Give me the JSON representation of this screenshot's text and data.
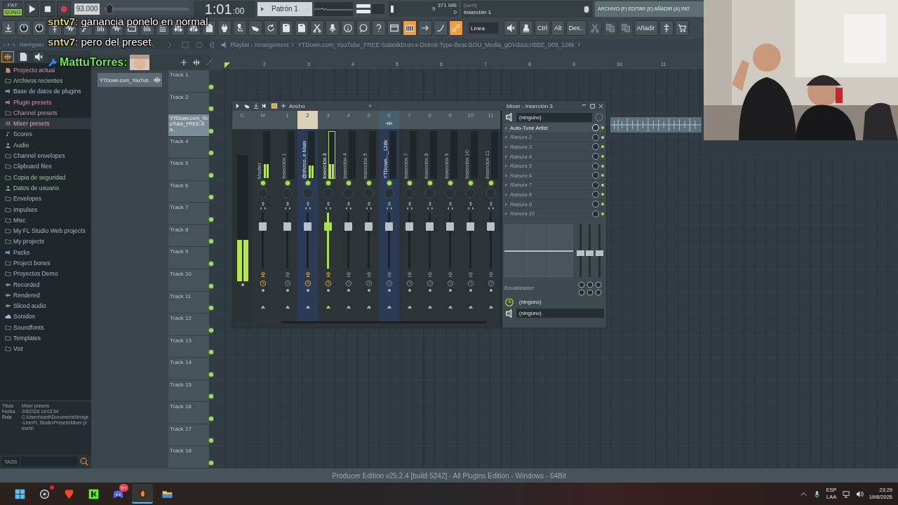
{
  "chat": [
    {
      "user": "sntv7",
      "text": ": ganancia ponelo en normal",
      "avatar": false
    },
    {
      "user": "sntv7",
      "text": ": pero del preset",
      "avatar": false
    },
    {
      "user": "MattuTorres:",
      "avatar": true
    }
  ],
  "transport": {
    "mode_labels": [
      "PAT",
      "SONG"
    ],
    "song_mode": true,
    "tempo": "93.000",
    "position_slider": {
      "level": 0.02
    },
    "time": "1:01",
    "time_small": ":00",
    "pattern": "Patrón 1",
    "cpu": "9",
    "memory": "371 MB",
    "polyphony": "0",
    "hint_title": "[santi]",
    "hint_text": "Inserción 1",
    "menu_hint": "ARCHIVO (F) EDITAR (E) AÑADIR (A) PAT"
  },
  "toolbar": [
    {
      "kind": "icon",
      "on": false,
      "disabled": false
    },
    {
      "kind": "icon",
      "on": false,
      "disabled": false
    },
    {
      "kind": "icon",
      "on": false,
      "disabled": false
    },
    {
      "kind": "icon",
      "on": false,
      "disabled": false
    },
    {
      "kind": "icon",
      "on": false,
      "disabled": false
    },
    {
      "kind": "icon",
      "on": false,
      "disabled": false
    },
    {
      "kind": "icon",
      "on": false,
      "disabled": false
    },
    {
      "kind": "icon",
      "on": false,
      "disabled": false
    },
    {
      "kind": "icon",
      "on": false,
      "disabled": false
    },
    {
      "kind": "icon",
      "on": false,
      "disabled": false
    },
    {
      "kind": "icon",
      "on": false,
      "disabled": false
    },
    {
      "kind": "icon",
      "on": false,
      "disabled": false
    },
    {
      "kind": "icon",
      "on": false,
      "disabled": false
    },
    {
      "kind": "icon",
      "on": false,
      "disabled": false
    },
    {
      "kind": "icon",
      "on": false,
      "disabled": false
    },
    {
      "kind": "icon",
      "on": false,
      "disabled": false
    },
    {
      "kind": "icon",
      "on": false,
      "disabled": false
    },
    {
      "kind": "icon",
      "on": false,
      "disabled": false
    },
    {
      "kind": "icon",
      "on": false,
      "disabled": false
    },
    {
      "kind": "icon",
      "on": false,
      "disabled": false
    },
    {
      "kind": "icon",
      "on": false,
      "disabled": false
    },
    {
      "kind": "icon",
      "on": false,
      "disabled": false
    },
    {
      "kind": "icon",
      "on": false,
      "disabled": false
    },
    {
      "kind": "icon",
      "on": false,
      "disabled": false
    },
    {
      "kind": "icon",
      "on": false,
      "disabled": false
    },
    {
      "kind": "icon",
      "on": false,
      "disabled": false
    },
    {
      "kind": "icon",
      "on": true,
      "disabled": false
    },
    {
      "kind": "icon",
      "on": false,
      "disabled": false
    },
    {
      "kind": "icon",
      "on": false,
      "disabled": false
    },
    {
      "kind": "icon",
      "on": true,
      "disabled": false
    },
    {
      "kind": "dropdown",
      "label": "Línea",
      "on": false,
      "disabled": false
    },
    {
      "kind": "icon",
      "on": false,
      "disabled": false
    },
    {
      "kind": "icon",
      "on": false,
      "disabled": false
    },
    {
      "kind": "text",
      "label": "Ctrl",
      "on": false,
      "disabled": false
    },
    {
      "kind": "text",
      "label": "Alt",
      "on": false,
      "disabled": false
    },
    {
      "kind": "text",
      "label": "Des..",
      "on": false,
      "disabled": false
    },
    {
      "kind": "icon",
      "on": false,
      "disabled": true
    },
    {
      "kind": "icon",
      "on": false,
      "disabled": true
    },
    {
      "kind": "icon",
      "on": false,
      "disabled": true
    },
    {
      "kind": "text",
      "label": "Añadir",
      "on": false,
      "disabled": false
    },
    {
      "kind": "icon",
      "on": false,
      "disabled": false
    },
    {
      "kind": "icon",
      "on": false,
      "disabled": false
    }
  ],
  "navigation": {
    "browser_label": "Navegado",
    "playlist_title": "Playlist - Arrangement",
    "playlist_file": "YTDown.com_YouTube_FREE-Salastkbron-x-Detroit-Type-Beat-BOU_Media_gDVdouLH5BE_009_128k"
  },
  "browser": {
    "items": [
      {
        "label": "Proyecto actual",
        "kind": "project",
        "selected": false
      },
      {
        "label": "Archivos recientes",
        "kind": "recent",
        "selected": false
      },
      {
        "label": "Base de datos de plugins",
        "kind": "plugins",
        "selected": false
      },
      {
        "label": "Plugin presets",
        "kind": "presets",
        "selected": false
      },
      {
        "label": "Channel presets",
        "kind": "channel",
        "selected": false
      },
      {
        "label": "Mixer presets",
        "kind": "mixer",
        "selected": true
      },
      {
        "label": "Scores",
        "kind": "scores",
        "selected": false
      },
      {
        "label": "Audio",
        "kind": "user",
        "selected": false
      },
      {
        "label": "Channel envelopes",
        "kind": "folder",
        "selected": false
      },
      {
        "label": "Clipboard files",
        "kind": "folder",
        "selected": false
      },
      {
        "label": "Copia de seguridad",
        "kind": "recent",
        "selected": false
      },
      {
        "label": "Datos de usuario",
        "kind": "user",
        "selected": false
      },
      {
        "label": "Envelopes",
        "kind": "folder",
        "selected": false
      },
      {
        "label": "Impulses",
        "kind": "folder",
        "selected": false
      },
      {
        "label": "Misc",
        "kind": "folder",
        "selected": false
      },
      {
        "label": "My FL Studio Web projects",
        "kind": "folder",
        "selected": false
      },
      {
        "label": "My projects",
        "kind": "folder",
        "selected": false
      },
      {
        "label": "Packs",
        "kind": "packs",
        "selected": false
      },
      {
        "label": "Project bones",
        "kind": "folder",
        "selected": false
      },
      {
        "label": "Proyectos Demo",
        "kind": "folder",
        "selected": false
      },
      {
        "label": "Recorded",
        "kind": "audio",
        "selected": false
      },
      {
        "label": "Rendered",
        "kind": "audio",
        "selected": false
      },
      {
        "label": "Sliced audio",
        "kind": "audio",
        "selected": false
      },
      {
        "label": "Sonidos",
        "kind": "cloud",
        "selected": false
      },
      {
        "label": "Soundfonts",
        "kind": "folder",
        "selected": false
      },
      {
        "label": "Templates",
        "kind": "folder",
        "selected": false
      },
      {
        "label": "Voz",
        "kind": "folder",
        "selected": false
      }
    ],
    "info": [
      {
        "key": "Título",
        "value": "Mixer presets"
      },
      {
        "key": "Fecha",
        "value": "2/8/2026 14:03:54"
      },
      {
        "key": "Ruta",
        "value": "C:\\Users\\santi\\Documents\\Image-Line\\FL Studio\\Presets\\Mixer presets\\"
      }
    ],
    "tags_label": "TAGS"
  },
  "picker": {
    "clips": [
      "YTDown.com_YouTub.."
    ]
  },
  "playlist": {
    "ruler": [
      "2",
      "3",
      "4",
      "5",
      "6",
      "7",
      "8",
      "9",
      "10",
      "11"
    ],
    "tracks": [
      {
        "kind": "track",
        "name": "Track 1",
        "enabled": true
      },
      {
        "kind": "track",
        "name": "Track 2",
        "enabled": true
      },
      {
        "kind": "clip",
        "name": "YTDown.com_YouTube_FREE-Sa..",
        "enabled": true
      },
      {
        "kind": "track",
        "name": "Track 4",
        "enabled": true
      },
      {
        "kind": "track",
        "name": "Track 5",
        "enabled": true
      },
      {
        "kind": "track",
        "name": "Track 6",
        "enabled": true
      },
      {
        "kind": "track",
        "name": "Track 7",
        "enabled": true
      },
      {
        "kind": "track",
        "name": "Track 8",
        "enabled": true
      },
      {
        "kind": "track",
        "name": "Track 9",
        "enabled": true
      },
      {
        "kind": "track",
        "name": "Track 10",
        "enabled": true
      },
      {
        "kind": "track",
        "name": "Track 11",
        "enabled": true
      },
      {
        "kind": "track",
        "name": "Track 12",
        "enabled": true
      },
      {
        "kind": "track",
        "name": "Track 13",
        "enabled": true
      },
      {
        "kind": "track",
        "name": "Track 14",
        "enabled": true
      },
      {
        "kind": "track",
        "name": "Track 15",
        "enabled": true
      },
      {
        "kind": "track",
        "name": "Track 16",
        "enabled": true
      },
      {
        "kind": "track",
        "name": "Track 17",
        "enabled": true
      },
      {
        "kind": "track",
        "name": "Track 18",
        "enabled": true
      }
    ]
  },
  "mixer": {
    "width_label": "Ancho",
    "current_label": "C",
    "current_meter": {
      "level": 0.33
    },
    "strips": [
      {
        "number": "M",
        "name": "Master",
        "selected": false,
        "linked": false,
        "header_lit": false,
        "audio": false,
        "send_on": true,
        "level": 0.8,
        "meter": {
          "level": 0.3
        }
      },
      {
        "number": "1",
        "name": "Inserción 1",
        "selected": false,
        "linked": false,
        "header_lit": false,
        "audio": false,
        "send_on": false,
        "level": 0.8
      },
      {
        "number": "2",
        "name": "@shzoo..e Main",
        "selected": false,
        "linked": true,
        "header_lit": true,
        "audio": false,
        "send_on": true,
        "level": 0.8,
        "meter": {
          "level": 0.28
        }
      },
      {
        "number": "3",
        "name": "Inserción 3",
        "selected": true,
        "linked": false,
        "header_lit": false,
        "audio": false,
        "send_on": true,
        "level": 0.8,
        "meter": {
          "level": 0.3
        }
      },
      {
        "number": "4",
        "name": "Inserción 4",
        "selected": false,
        "linked": false,
        "header_lit": false,
        "audio": false,
        "send_on": false,
        "level": 0.8
      },
      {
        "number": "5",
        "name": "Inserción 5",
        "selected": false,
        "linked": false,
        "header_lit": false,
        "audio": false,
        "send_on": false,
        "level": 0.8
      },
      {
        "number": "6",
        "name": "YTDown..._128k",
        "selected": false,
        "linked": true,
        "header_lit": false,
        "audio": true,
        "send_on": false,
        "level": 0.8
      },
      {
        "number": "7",
        "name": "Inserción 7",
        "selected": false,
        "linked": false,
        "header_lit": false,
        "audio": false,
        "send_on": false,
        "level": 0.8
      },
      {
        "number": "8",
        "name": "Inserción 8",
        "selected": false,
        "linked": false,
        "header_lit": false,
        "audio": false,
        "send_on": false,
        "level": 0.8
      },
      {
        "number": "9",
        "name": "Inserción 9",
        "selected": false,
        "linked": false,
        "header_lit": false,
        "audio": false,
        "send_on": false,
        "level": 0.8
      },
      {
        "number": "10",
        "name": "Inserción 10",
        "selected": false,
        "linked": false,
        "header_lit": false,
        "audio": false,
        "send_on": false,
        "level": 0.8
      },
      {
        "number": "11",
        "name": "Inserción 11",
        "selected": false,
        "linked": false,
        "header_lit": false,
        "audio": false,
        "send_on": false,
        "level": 0.8
      }
    ],
    "inspector": {
      "title": "Mixer - Inserción 3",
      "input": "(ninguno)",
      "slots": [
        {
          "name": "Auto-Tune Artist",
          "filled": true
        },
        {
          "name": "Ranura 2",
          "filled": false
        },
        {
          "name": "Ranura 3",
          "filled": false
        },
        {
          "name": "Ranura 4",
          "filled": false
        },
        {
          "name": "Ranura 5",
          "filled": false
        },
        {
          "name": "Ranura 6",
          "filled": false
        },
        {
          "name": "Ranura 7",
          "filled": false
        },
        {
          "name": "Ranura 8",
          "filled": false
        },
        {
          "name": "Ranura 9",
          "filled": false
        },
        {
          "name": "Ranura 10",
          "filled": false
        }
      ],
      "eq_label": "Ecualizador",
      "eq_bands": [
        {
          "level": 0.45
        },
        {
          "level": 0.45
        },
        {
          "level": 0.45
        }
      ],
      "send": "(ninguno)",
      "output": "(ninguno)"
    }
  },
  "status_bar": "Producer Edition v25.2.4 [build 5242] - All Plugins Edition - Windows - 64Bit",
  "taskbar": {
    "apps": [
      {
        "kind": "start",
        "active": false
      },
      {
        "kind": "recorder",
        "active": false,
        "dot": true
      },
      {
        "kind": "lion",
        "active": false
      },
      {
        "kind": "green-k",
        "active": false
      },
      {
        "kind": "chat",
        "active": false,
        "badge": "9+"
      },
      {
        "kind": "fruit",
        "active": true
      },
      {
        "kind": "folder",
        "active": false
      }
    ],
    "language": "ESP",
    "layout": "LAA",
    "time": "23:29",
    "date": "19/8/2026"
  }
}
